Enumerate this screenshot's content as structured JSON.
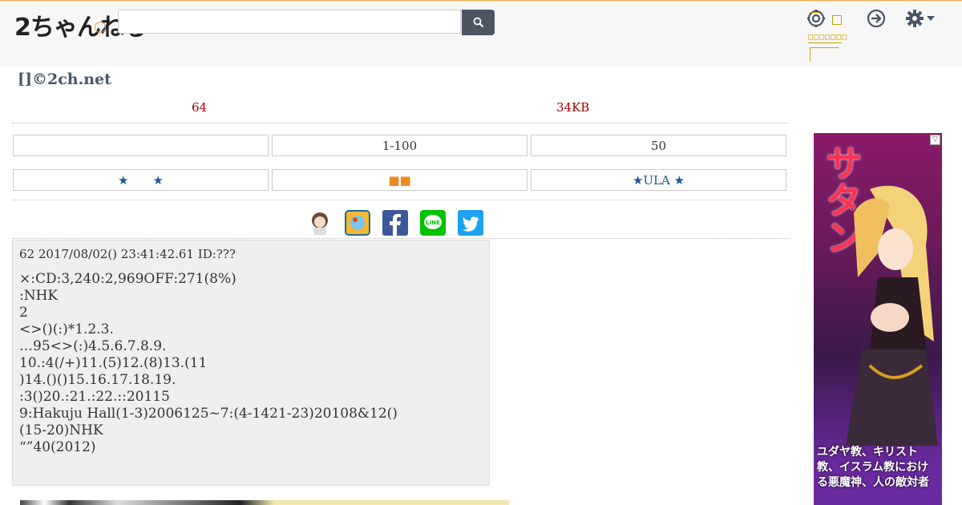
{
  "header": {
    "logo_text": "2ちゃんねる",
    "search_placeholder": "",
    "search_icon": "search-icon",
    "icons": [
      "settings-circle-icon",
      "login-icon",
      "gear-dropdown-icon"
    ],
    "gold_box_text": "□□",
    "gold_box_line": "□□□□□□□"
  },
  "thread": {
    "title": "[]©2ch.net",
    "replies": "64",
    "size": "34KB"
  },
  "nav_row1": [
    "",
    "1-100",
    "50"
  ],
  "nav_row2": [
    "★　　★",
    "■■",
    "★ULA ★"
  ],
  "share_icons": [
    "avatar-share-icon",
    "bookmark-share-icon",
    "facebook-icon",
    "line-icon",
    "twitter-icon"
  ],
  "post": {
    "header": "62  2017/08/02() 23:41:42.61   ID:???",
    "lines": [
      "×:CD:3,240:2,969OFF:271(8%)",
      ":NHK",
      "2",
      "<>()(:)*1.2.3.",
      "…95<>(:)4.5.6.7.8.9.",
      "10.:4(/+)11.(5)12.(8)13.(11",
      ")14.()()15.16.17.18.19.",
      ":3()20.:21.:22.::20115",
      "9:Hakuju Hall(1-3)2006125~7:(4-1421-23)20108&12()",
      "(15-20)NHK",
      "“”40(2012)"
    ]
  },
  "ad": {
    "title": "サタン",
    "caption": "ユダヤ教、キリスト教、イスラム教における悪魔神、人の敵対者",
    "badge": "▽"
  },
  "colors": {
    "accent_red": "#a00000",
    "nav_blue": "#1a5a9a",
    "orange": "#f08a20",
    "gold": "#c8a000",
    "search_btn": "#4b5564"
  }
}
